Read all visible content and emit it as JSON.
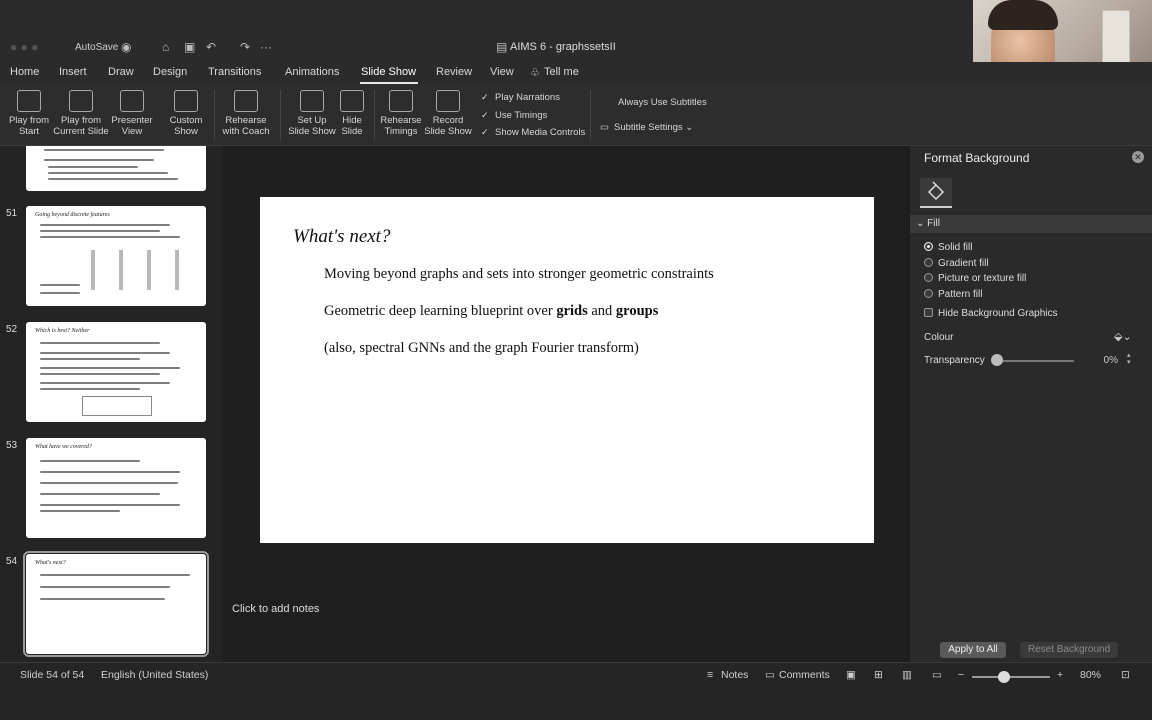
{
  "titlebar": {
    "autosave_label": "AutoSave",
    "doc_title": "AIMS 6 - graphssetsII"
  },
  "tabs": [
    "Home",
    "Insert",
    "Draw",
    "Design",
    "Transitions",
    "Animations",
    "Slide Show",
    "Review",
    "View",
    "Tell me"
  ],
  "active_tab": "Slide Show",
  "ribbon": {
    "play_from_start": [
      "Play from",
      "Start"
    ],
    "play_from_current": [
      "Play from",
      "Current Slide"
    ],
    "presenter_view": [
      "Presenter",
      "View"
    ],
    "custom_show": [
      "Custom",
      "Show"
    ],
    "rehearse_with_coach": [
      "Rehearse",
      "with Coach"
    ],
    "set_up_slide_show": [
      "Set Up",
      "Slide Show"
    ],
    "hide_slide": [
      "Hide",
      "Slide"
    ],
    "rehearse_timings": [
      "Rehearse",
      "Timings"
    ],
    "record_slide_show": [
      "Record",
      "Slide Show"
    ],
    "play_narrations": "Play Narrations",
    "use_timings": "Use Timings",
    "show_media_controls": "Show Media Controls",
    "always_use_subtitles": "Always Use Subtitles",
    "subtitle_settings": "Subtitle Settings"
  },
  "thumbnails": [
    {
      "number": "",
      "title": ""
    },
    {
      "number": "51",
      "title": "Going beyond discrete features"
    },
    {
      "number": "52",
      "title": "Which is best? Neither"
    },
    {
      "number": "53",
      "title": "What have we covered?"
    },
    {
      "number": "54",
      "title": "What's next?"
    }
  ],
  "slide": {
    "title": "What's next?",
    "bullet1": "Moving beyond graphs and sets into stronger geometric constraints",
    "bullet2_pre": "Geometric deep learning blueprint over ",
    "bullet2_b1": "grids",
    "bullet2_mid": " and ",
    "bullet2_b2": "groups",
    "bullet3": "(also, spectral GNNs and the graph Fourier transform)"
  },
  "notes_placeholder": "Click to add notes",
  "format_pane": {
    "title": "Format Background",
    "section": "Fill",
    "options": [
      "Solid fill",
      "Gradient fill",
      "Picture or texture fill",
      "Pattern fill",
      "Hide Background Graphics"
    ],
    "selected": "Solid fill",
    "colour_label": "Colour",
    "transparency_label": "Transparency",
    "transparency_value": "0%",
    "apply_all": "Apply to All",
    "reset": "Reset Background"
  },
  "status": {
    "slide_counter": "Slide 54 of 54",
    "language": "English (United States)",
    "notes": "Notes",
    "comments": "Comments",
    "zoom": "80%"
  }
}
